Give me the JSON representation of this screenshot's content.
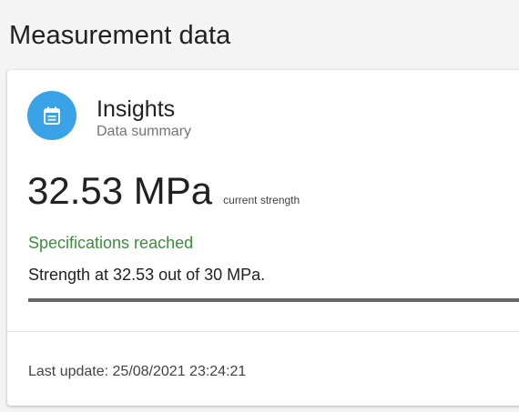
{
  "page": {
    "title": "Measurement data"
  },
  "card": {
    "icon": "calendar-note-icon",
    "accent_color": "#3aa3e8",
    "title": "Insights",
    "subtitle": "Data summary",
    "value": "32.53 MPa",
    "value_caption": "current strength",
    "status": "Specifications reached",
    "status_color": "#3b8e3b",
    "detail": "Strength at 32.53 out of 30 MPa.",
    "progress_fraction": 1.0,
    "last_update": "Last update: 25/08/2021 23:24:21"
  }
}
